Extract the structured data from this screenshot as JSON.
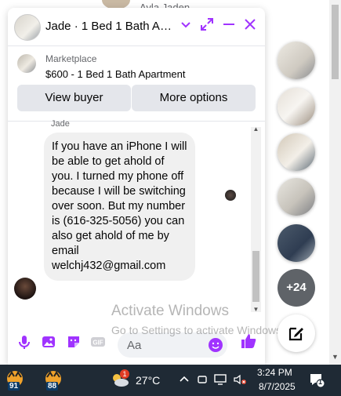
{
  "background": {
    "contact_name": "Ayla Jaden"
  },
  "chat": {
    "title": "Jade · 1 Bed 1 Bath Ap...",
    "marketplace_label": "Marketplace",
    "listing_title": "$600 - 1 Bed 1 Bath Apartment",
    "view_buyer_label": "View buyer",
    "more_options_label": "More options",
    "sender_name": "Jade",
    "message_text": "If you have an iPhone I will be able to get ahold of you. I turned my phone off because I will be switching over soon. But my number is (616-325-5056) you can also get ahold of me by email welchj432@gmail.com",
    "input_placeholder": "Aa",
    "accent_color": "#a033ff"
  },
  "watermark": {
    "line1": "Activate Windows",
    "line2": "Go to Settings to activate Windows."
  },
  "side_bubbles": {
    "more_count": "+24"
  },
  "taskbar": {
    "app1_badge": "91",
    "app2_badge": "88",
    "weather_alert_count": "1",
    "temperature": "27°C",
    "time": "3:24 PM",
    "date": "8/7/2025",
    "notification_count": "1"
  }
}
